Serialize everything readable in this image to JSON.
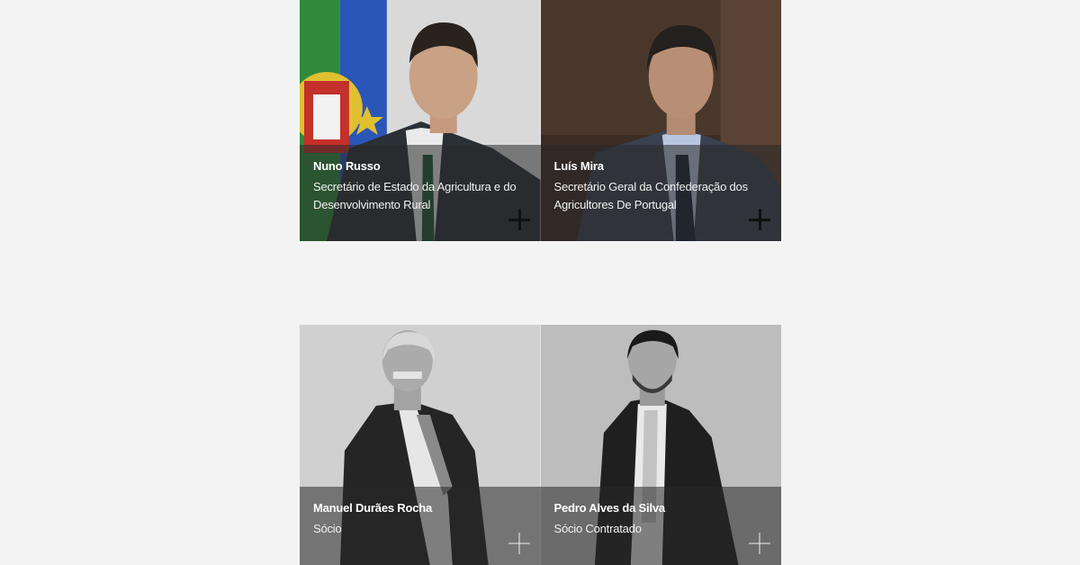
{
  "people": [
    {
      "name": "Nuno Russo",
      "role": "Secretário de Estado da Agricultura e do Desenvolvimento Rural"
    },
    {
      "name": "Luís Mira",
      "role": "Secretário Geral da Confederação dos Agricultores De Portugal"
    },
    {
      "name": "Manuel Durães Rocha",
      "role": "Sócio"
    },
    {
      "name": "Pedro Alves da Silva",
      "role": "Sócio Contratado"
    }
  ],
  "colors": {
    "page_background": "#f3f3f3",
    "overlay": "rgba(40,40,40,0.55)",
    "expand_icon_dark": "#111111"
  },
  "icons": [
    "expand-plus-icon"
  ]
}
